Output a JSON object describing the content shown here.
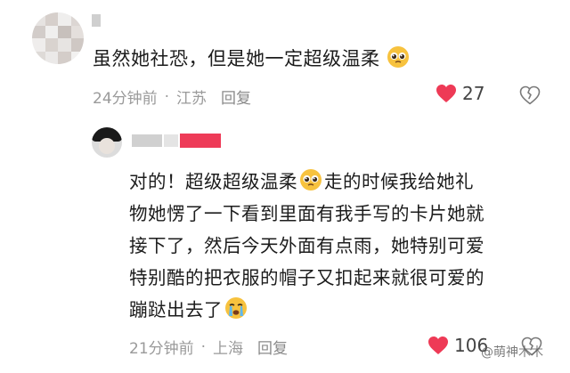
{
  "comment1": {
    "text": "虽然她社恐，但是她一定超级温柔",
    "time": "24分钟前",
    "location": "江苏",
    "reply_label": "回复",
    "likes": "27",
    "emoji": "pleading-face"
  },
  "comment2": {
    "line1_a": "对的！超级超级温柔",
    "line1_b": "走的时候我给她礼",
    "line2": "物她愣了一下看到里面有我手写的卡片她就",
    "line3": "接下了，然后今天外面有点雨，她特别可爱",
    "line4": "特别酷的把衣服的帽子又扣起来就很可爱的",
    "line5": "蹦跶出去了",
    "time": "21分钟前",
    "location": "上海",
    "reply_label": "回复",
    "likes": "106",
    "emojis": [
      "pleading-face",
      "crying-face"
    ]
  },
  "colors": {
    "like_red": "#ee3a56",
    "meta_gray": "#9a9a9a",
    "text": "#1c1c1c"
  },
  "watermark": "@萌神木木"
}
